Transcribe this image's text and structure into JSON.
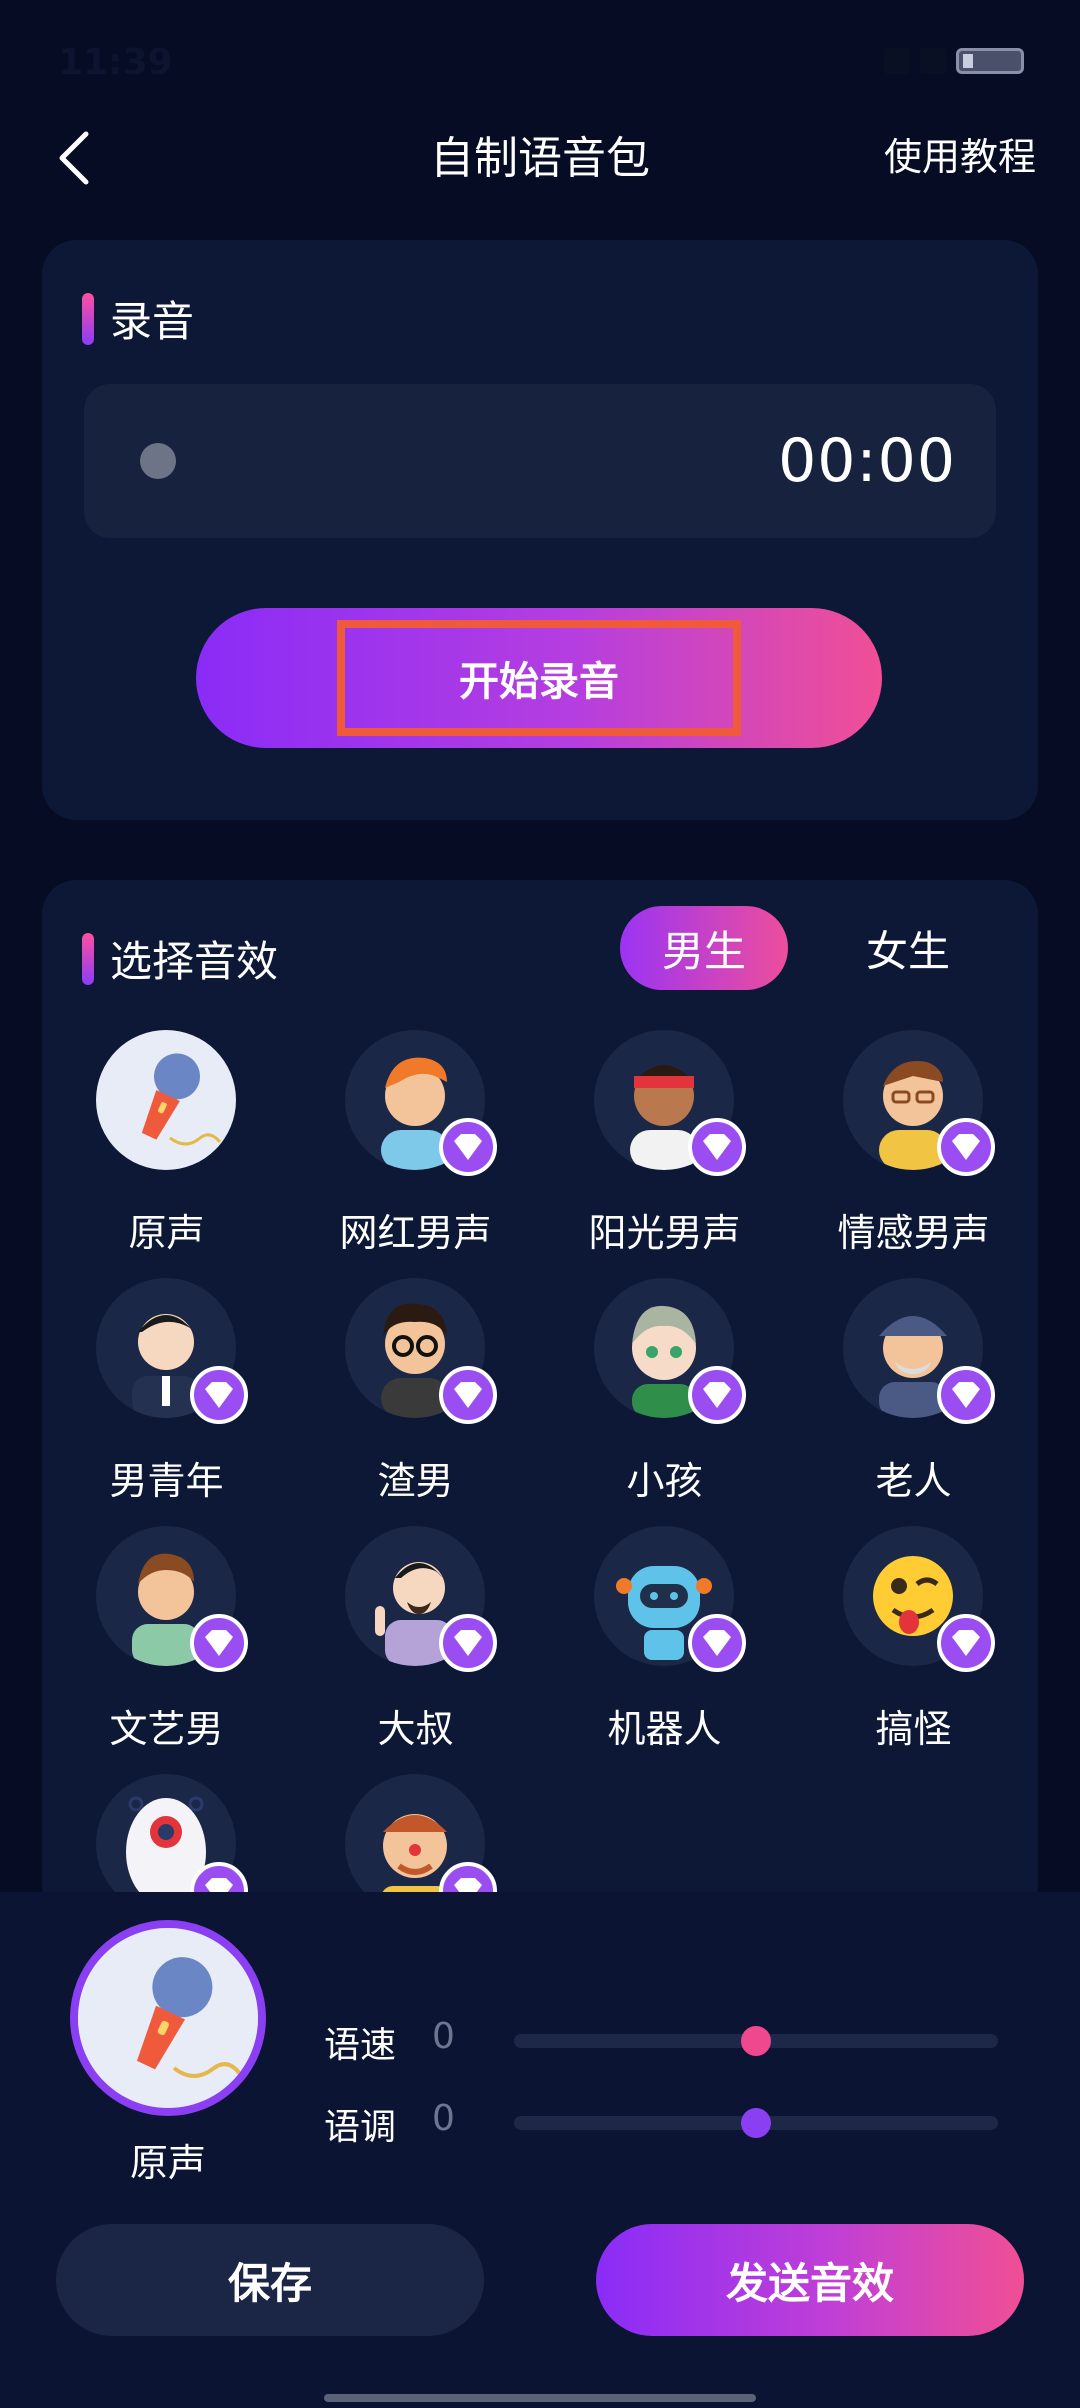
{
  "status_bar": {
    "time": "11:39"
  },
  "header": {
    "title": "自制语音包",
    "tutorial_label": "使用教程"
  },
  "recording": {
    "section_title": "录音",
    "timer": "00:00",
    "start_label": "开始录音"
  },
  "effects": {
    "section_title": "选择音效",
    "tabs": [
      {
        "label": "男生",
        "active": true
      },
      {
        "label": "女生",
        "active": false
      }
    ],
    "items": [
      {
        "name": "原声",
        "icon": "microphone-icon",
        "vip": false
      },
      {
        "name": "网红男声",
        "icon": "avatar-trendy-man-icon",
        "vip": true
      },
      {
        "name": "阳光男声",
        "icon": "avatar-headband-man-icon",
        "vip": true
      },
      {
        "name": "情感男声",
        "icon": "avatar-glasses-man-icon",
        "vip": true
      },
      {
        "name": "男青年",
        "icon": "avatar-suit-man-icon",
        "vip": true
      },
      {
        "name": "渣男",
        "icon": "avatar-round-glasses-man-icon",
        "vip": true
      },
      {
        "name": "小孩",
        "icon": "avatar-child-icon",
        "vip": true
      },
      {
        "name": "老人",
        "icon": "avatar-old-man-icon",
        "vip": true
      },
      {
        "name": "文艺男",
        "icon": "avatar-artsy-man-icon",
        "vip": true
      },
      {
        "name": "大叔",
        "icon": "avatar-uncle-icon",
        "vip": true
      },
      {
        "name": "机器人",
        "icon": "avatar-robot-icon",
        "vip": true
      },
      {
        "name": "搞怪",
        "icon": "avatar-funny-emoji-icon",
        "vip": true
      },
      {
        "name": "",
        "icon": "avatar-alien-icon",
        "vip": true
      },
      {
        "name": "",
        "icon": "avatar-clown-icon",
        "vip": true
      }
    ]
  },
  "selected": {
    "name": "原声",
    "speed_label": "语速",
    "speed_value": "0",
    "speed_fraction": 0.5,
    "pitch_label": "语调",
    "pitch_value": "0",
    "pitch_fraction": 0.5
  },
  "actions": {
    "save_label": "保存",
    "send_label": "发送音效"
  },
  "colors": {
    "background": "#050c24",
    "card": "#0c1836",
    "accent_purple": "#8a2cf7",
    "accent_pink": "#f04f95",
    "speed_thumb": "#f0488f",
    "pitch_thumb": "#8b3ff2",
    "highlight_border": "#f05a3c"
  }
}
